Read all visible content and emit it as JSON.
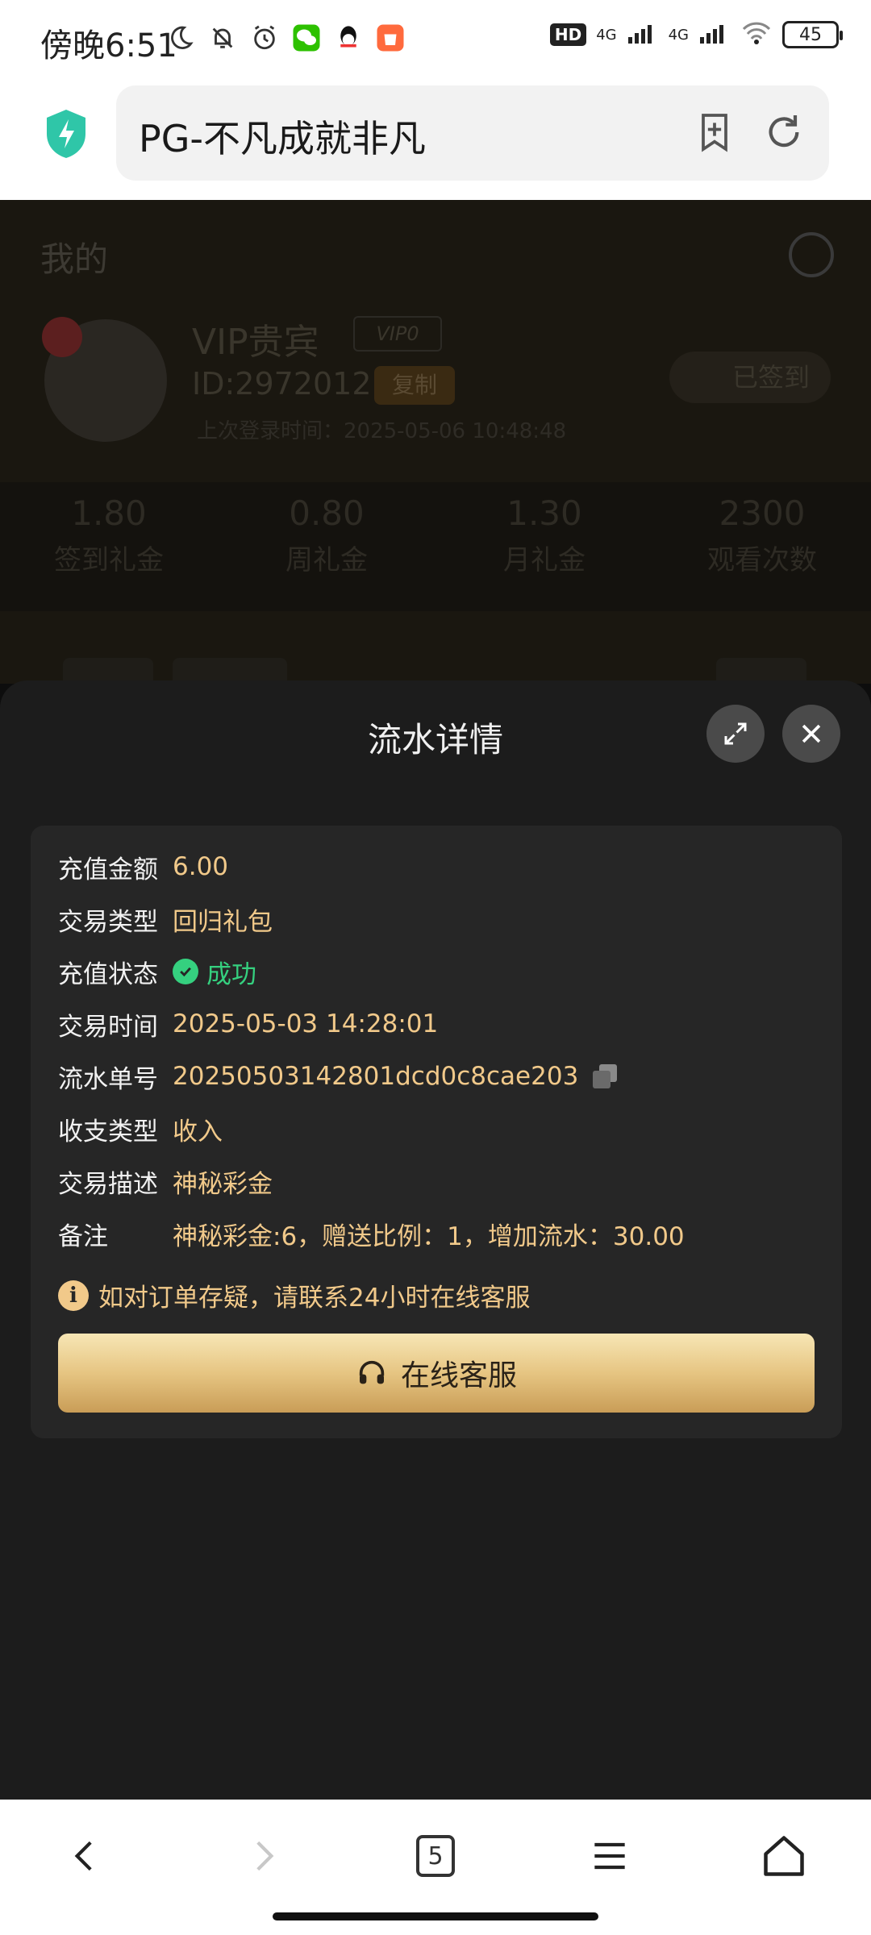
{
  "status_bar": {
    "time": "傍晚6:51",
    "hd_badge": "HD",
    "network_1": "4G",
    "network_2": "4G",
    "battery": "45"
  },
  "browser": {
    "url_title": "PG-不凡成就非凡",
    "tab_count": "5"
  },
  "background_page": {
    "title": "我的",
    "user_level": "VIP贵宾",
    "vip_badge": "VIP0",
    "user_id": "ID:2972012",
    "copy_label": "复制",
    "last_login": "上次登录时间：2025-05-06 10:48:48",
    "signed_label": "已签到",
    "stats": [
      {
        "value": "1.80",
        "label": "签到礼金"
      },
      {
        "value": "0.80",
        "label": "周礼金"
      },
      {
        "value": "1.30",
        "label": "月礼金"
      },
      {
        "value": "2300",
        "label": "观看次数"
      }
    ]
  },
  "modal": {
    "title": "流水详情",
    "rows": [
      {
        "label": "充值金额",
        "value": "6.00"
      },
      {
        "label": "交易类型",
        "value": "回归礼包"
      },
      {
        "label": "充值状态",
        "value": "成功"
      },
      {
        "label": "交易时间",
        "value": "2025-05-03 14:28:01"
      },
      {
        "label": "流水单号",
        "value": "20250503142801dcd0c8cae203"
      },
      {
        "label": "收支类型",
        "value": "收入"
      },
      {
        "label": "交易描述",
        "value": "神秘彩金"
      },
      {
        "label": "备注",
        "value": "神秘彩金:6，赠送比例：1，增加流水：30.00"
      }
    ],
    "notice": "如对订单存疑，请联系24小时在线客服",
    "service_button": "在线客服"
  },
  "colors": {
    "accent_gold": "#f1c98a",
    "success_green": "#35d07f",
    "modal_bg": "#1c1c1c",
    "card_bg": "#262626"
  }
}
